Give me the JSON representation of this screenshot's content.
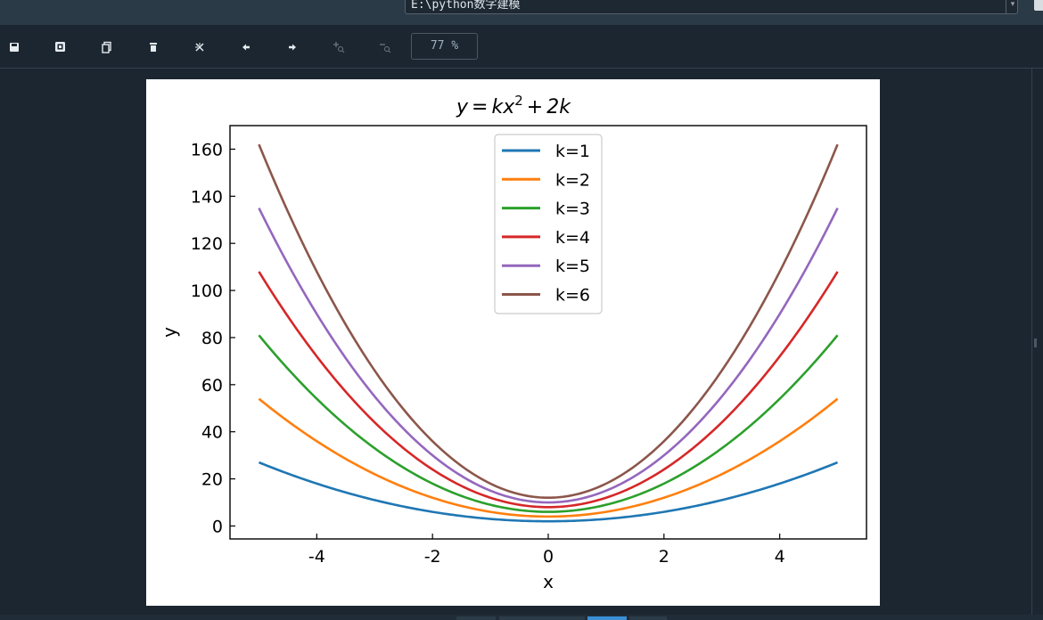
{
  "top": {
    "path": "E:\\python数字建模"
  },
  "toolbar": {
    "buttons": [
      {
        "icon": "save-icon",
        "glyph": "🖫"
      },
      {
        "icon": "save-all-icon",
        "glyph": "⧉"
      },
      {
        "icon": "copy-icon",
        "glyph": "❐"
      },
      {
        "icon": "delete-icon",
        "glyph": "🗑"
      },
      {
        "icon": "close-all-icon",
        "glyph": "✕"
      },
      {
        "icon": "previous-icon",
        "glyph": "←"
      },
      {
        "icon": "next-icon",
        "glyph": "→"
      },
      {
        "icon": "zoom-in-icon",
        "glyph": "+🔍",
        "disabled": true
      },
      {
        "icon": "zoom-out-icon",
        "glyph": "−🔍",
        "disabled": true
      }
    ],
    "zoom": "77 %"
  },
  "chart_data": {
    "type": "line",
    "title": "y = kx² + 2k",
    "title_parts": {
      "lhs": "y",
      "eq": "=",
      "k": "k",
      "x": "x",
      "exp": "2",
      "plus": "+",
      "coef": "2k"
    },
    "xlabel": "x",
    "ylabel": "y",
    "xlim": [
      -5.5,
      5.5
    ],
    "ylim": [
      -5.5,
      170
    ],
    "xticks": [
      -4,
      -2,
      0,
      2,
      4
    ],
    "yticks": [
      0,
      20,
      40,
      60,
      80,
      100,
      120,
      140,
      160
    ],
    "x_range": [
      -5,
      5
    ],
    "formula": "y = k*x^2 + 2*k",
    "legend_position": "upper center",
    "grid": false,
    "series": [
      {
        "name": "k=1",
        "k": 1,
        "color": "#1f77b4"
      },
      {
        "name": "k=2",
        "k": 2,
        "color": "#ff7f0e"
      },
      {
        "name": "k=3",
        "k": 3,
        "color": "#2ca02c"
      },
      {
        "name": "k=4",
        "k": 4,
        "color": "#d62728"
      },
      {
        "name": "k=5",
        "k": 5,
        "color": "#9467bd"
      },
      {
        "name": "k=6",
        "k": 6,
        "color": "#8c564b"
      }
    ]
  }
}
